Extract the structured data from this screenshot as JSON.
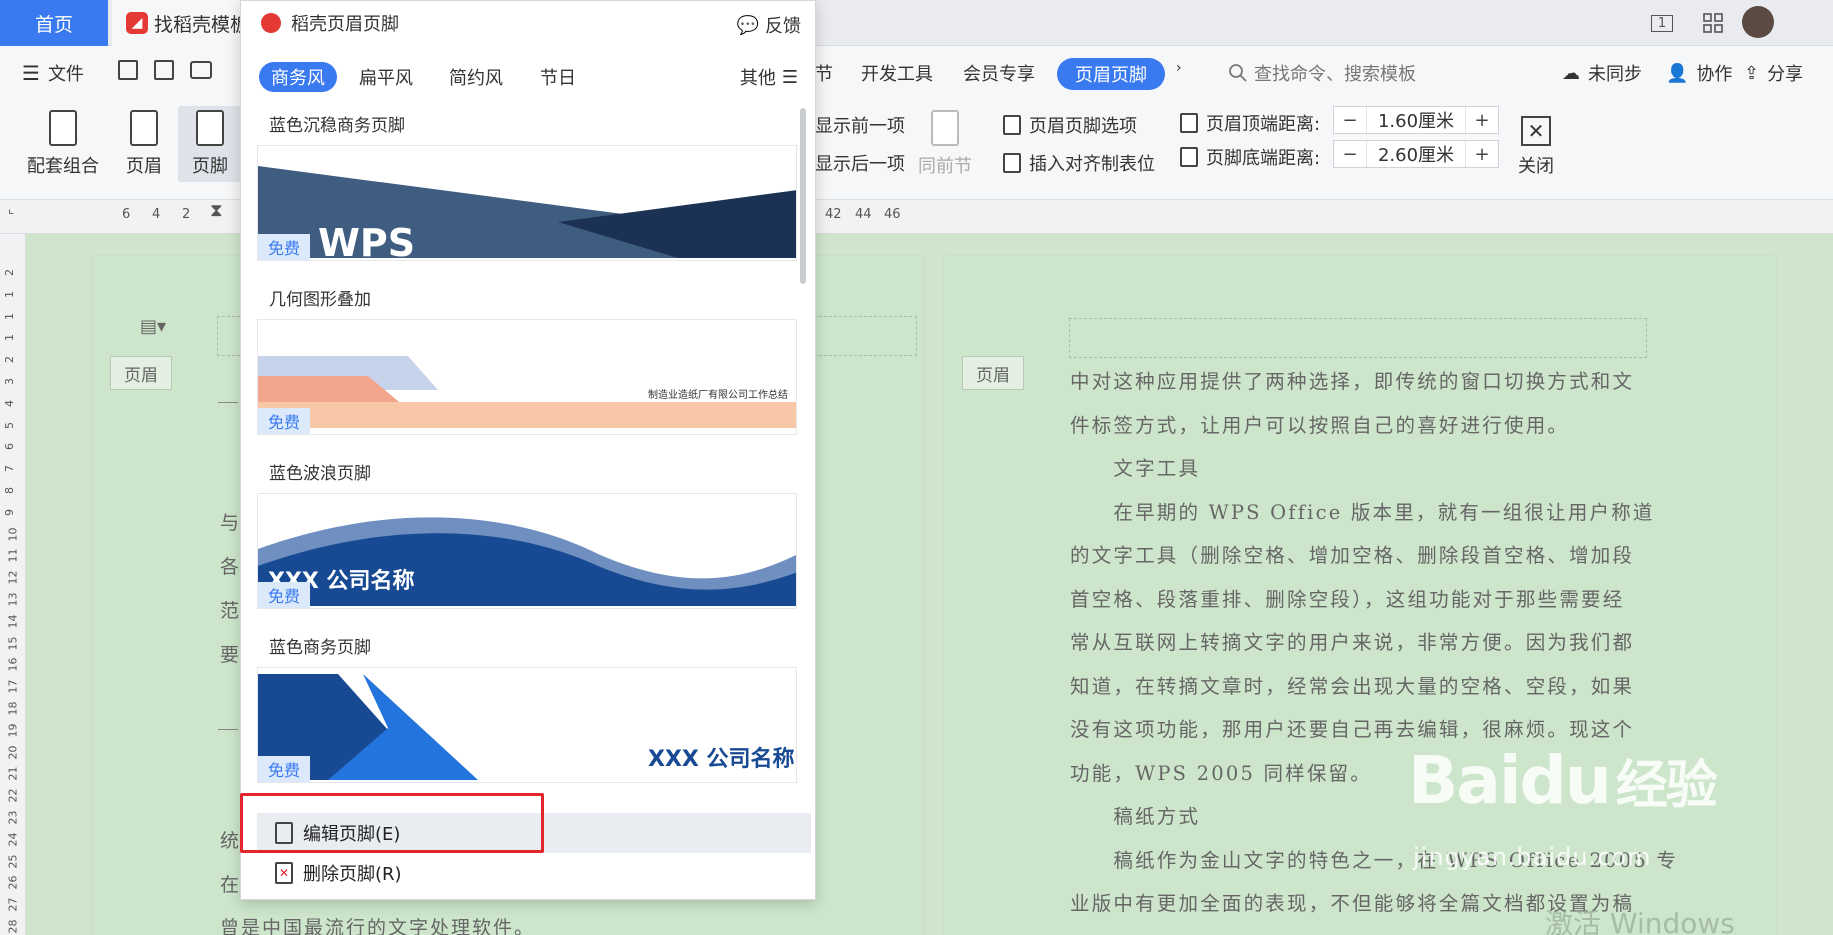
{
  "tabs": {
    "home": "首页",
    "template": "找稻壳模板"
  },
  "page_counter": "1",
  "menu": {
    "file": "文件",
    "items": [
      "节",
      "开发工具",
      "会员专享"
    ],
    "active": "页眉页脚",
    "search_placeholder": "查找命令、搜索模板",
    "unsynced": "未同步",
    "collab": "协作",
    "share": "分享"
  },
  "ribbon": {
    "combo": "配套组合",
    "header": "页眉",
    "footer": "页脚",
    "show_prev": "显示前一项",
    "show_next": "显示后一项",
    "same_section": "同前节",
    "hf_options": "页眉页脚选项",
    "insert_tab": "插入对齐制表位",
    "header_top_label": "页眉顶端距离:",
    "header_top_value": "1.60厘米",
    "footer_bottom_label": "页脚底端距离:",
    "footer_bottom_value": "2.60厘米",
    "close": "关闭"
  },
  "ruler": {
    "left": [
      "6",
      "4",
      "2"
    ],
    "right": [
      "42",
      "44",
      "46"
    ],
    "vertical": [
      "2",
      "1",
      "1",
      "1",
      "2",
      "3",
      "4",
      "5",
      "6",
      "7",
      "8",
      "9",
      "10",
      "11",
      "12",
      "13",
      "14",
      "15",
      "16",
      "17",
      "18",
      "19",
      "20",
      "21",
      "22",
      "23",
      "24",
      "25",
      "26",
      "27",
      "28"
    ]
  },
  "panel": {
    "title": "稻壳页眉页脚",
    "feedback": "反馈",
    "tabs": [
      "商务风",
      "扁平风",
      "简约风",
      "节日"
    ],
    "other": "其他",
    "templates": [
      {
        "name": "蓝色沉稳商务页脚",
        "badge": "免费",
        "text": "WPS"
      },
      {
        "name": "几何图形叠加",
        "badge": "免费",
        "text": "制造业造纸厂有限公司工作总结"
      },
      {
        "name": "蓝色波浪页脚",
        "badge": "免费",
        "text": "XXX 公司名称"
      },
      {
        "name": "蓝色商务页脚",
        "badge": "免费",
        "text": "XXX 公司名称"
      }
    ],
    "edit_footer": "编辑页脚(E)",
    "delete_footer": "删除页脚(R)"
  },
  "doc": {
    "header_tag": "页眉",
    "right_lines": [
      "中对这种应用提供了两种选择，即传统的窗口切换方式和文",
      "件标签方式，让用户可以按照自己的喜好进行使用。",
      "　　文字工具",
      "　　在早期的 WPS Office 版本里，就有一组很让用户称道",
      "的文字工具（删除空格、增加空格、删除段首空格、增加段",
      "首空格、段落重排、删除空段），这组功能对于那些需要经",
      "常从互联网上转摘文字的用户来说，非常方便。因为我们都",
      "知道，在转摘文章时，经常会出现大量的空格、空段，如果",
      "没有这项功能，那用户还要自己再去编辑，很麻烦。现这个",
      "功能，WPS 2005 同样保留。",
      "　　稿纸方式",
      "　　稿纸作为金山文字的特色之一，在 WPS Office 2005 专",
      "业版中有更加全面的表现，不但能够将全篇文档都设置为稿"
    ],
    "left_frags": [
      "与",
      "各",
      "范",
      "要",
      "统",
      "在"
    ],
    "left_last": "曾是中国最流行的文字处理软件。"
  },
  "watermark": {
    "baidu": "Baidu",
    "jingyan": "经验",
    "site": "jingyan.baidu.com",
    "windows": "激活 Windows"
  },
  "colors": {
    "accent": "#3a7af0",
    "doc_bg": "#cfe6cd",
    "highlight_red": "#e3262c"
  }
}
